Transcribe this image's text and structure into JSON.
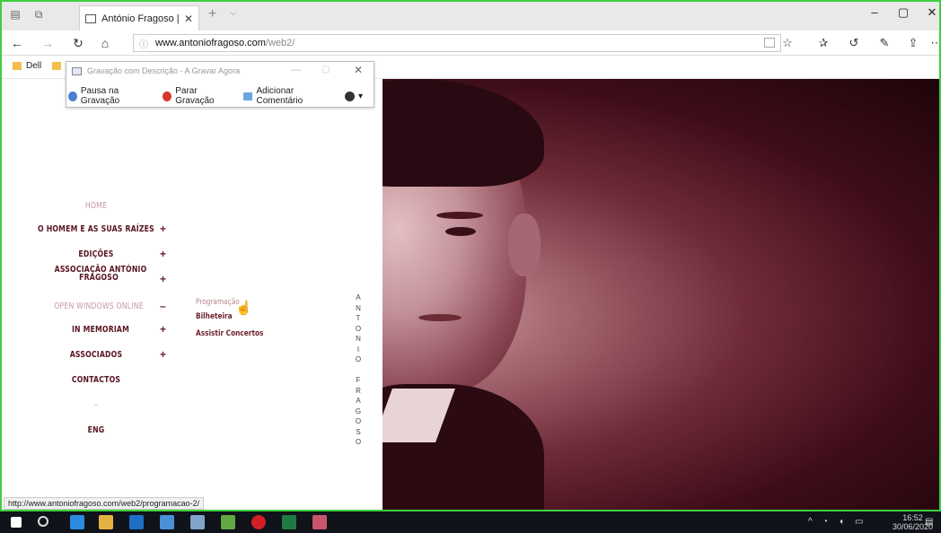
{
  "browser": {
    "tab_title": "António Fragoso | In Me",
    "new_tab": "+",
    "tab_dropdown": "⌵",
    "tab_close": "✕",
    "controls": {
      "minimize": "–",
      "maximize": "▢",
      "close": "✕"
    },
    "url_host": "www.antoniofragoso.com",
    "url_path": "/web2/",
    "favorites": {
      "item1": "Dell"
    }
  },
  "recorder": {
    "title": "Gravação com Descrição - A Gravar Agora",
    "pause": "Pausa na Gravação",
    "stop": "Parar Gravação",
    "add_comment": "Adicionar Comentário",
    "help": "▾"
  },
  "menu": {
    "home": "HOME",
    "o_homem": "O HOMEM E AS SUAS RAÍZES",
    "edicoes": "EDIÇÕES",
    "associacao_1": "ASSOCIAÇÃO ANTÓNIO",
    "associacao_2": "FRAGOSO",
    "open_windows": "OPEN WINDOWS ONLINE",
    "in_memoriam": "IN MEMORIAM",
    "associados": "ASSOCIADOS",
    "contactos": "CONTACTOS",
    "dash": "–",
    "eng": "ENG",
    "plus": "+",
    "minus": "–",
    "sub_programacao": "Programação",
    "sub_bilheteira": "Bilheteira",
    "sub_concertos": "Assistir Concertos"
  },
  "vertical_name": [
    "A",
    "N",
    "T",
    "O",
    "N",
    "I",
    "O",
    " ",
    "F",
    "R",
    "A",
    "G",
    "O",
    "S",
    "O"
  ],
  "status_url": "http://www.antoniofragoso.com/web2/programacao-2/",
  "clock": {
    "time": "16:52",
    "date": "30/06/2020"
  }
}
